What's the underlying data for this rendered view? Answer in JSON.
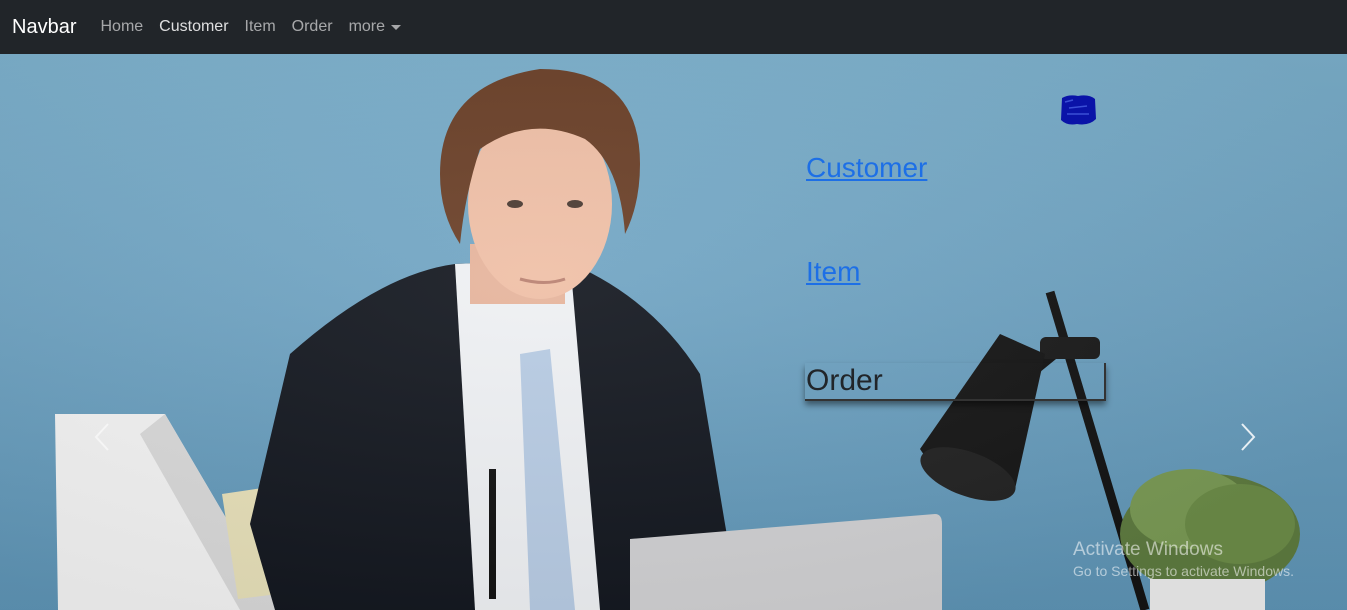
{
  "navbar": {
    "brand": "Navbar",
    "links": [
      {
        "label": "Home"
      },
      {
        "label": "Customer"
      },
      {
        "label": "Item"
      },
      {
        "label": "Order"
      }
    ],
    "more_label": "more"
  },
  "hero": {
    "links": {
      "customer": "Customer",
      "item": "Item",
      "order": "Order"
    },
    "logo_color": "#0a13a8"
  },
  "watermark": {
    "title": "Activate Windows",
    "subtitle": "Go to Settings to activate Windows."
  },
  "colors": {
    "navbar_bg": "#212529",
    "link": "#1d6fe6",
    "background": "#7aa9c5"
  },
  "icons": [
    "chevron-left-icon",
    "chevron-right-icon",
    "caret-down-icon"
  ]
}
